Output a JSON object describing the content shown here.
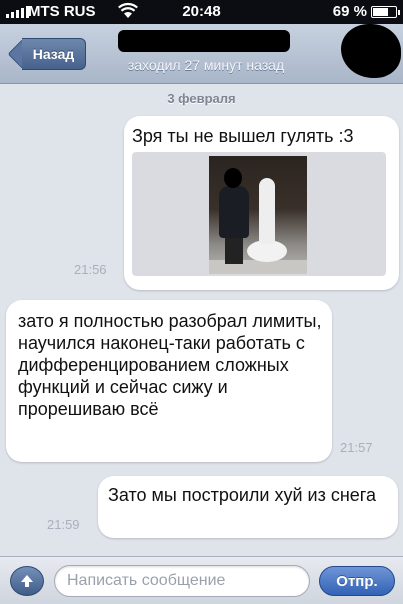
{
  "status_bar": {
    "carrier": "MTS RUS",
    "time": "20:48",
    "battery_percent": "69 %",
    "battery_level": 0.69
  },
  "nav": {
    "back_label": "Назад",
    "last_seen": "заходил 27 минут назад"
  },
  "chat": {
    "date_separator": "3 февраля",
    "messages": [
      {
        "direction": "outgoing",
        "text": "Зря ты не вышел гулять :3",
        "has_photo": true,
        "time": "21:56"
      },
      {
        "direction": "incoming",
        "text": "зато я полностью разобрал лимиты, научился наконец-таки работать с дифференцированием сложных функций и сейчас сижу и прорешиваю всё",
        "time": "21:57"
      },
      {
        "direction": "outgoing",
        "text": "Зато мы построили хуй из снега",
        "time": "21:59"
      }
    ]
  },
  "input_bar": {
    "placeholder": "Написать сообщение",
    "send_label": "Отпр.",
    "attach_icon": "arrow-up-icon"
  },
  "colors": {
    "chat_background": "#dfe3ea",
    "nav_gradient_top": "#c7d1df",
    "send_button": "#3262b6"
  }
}
